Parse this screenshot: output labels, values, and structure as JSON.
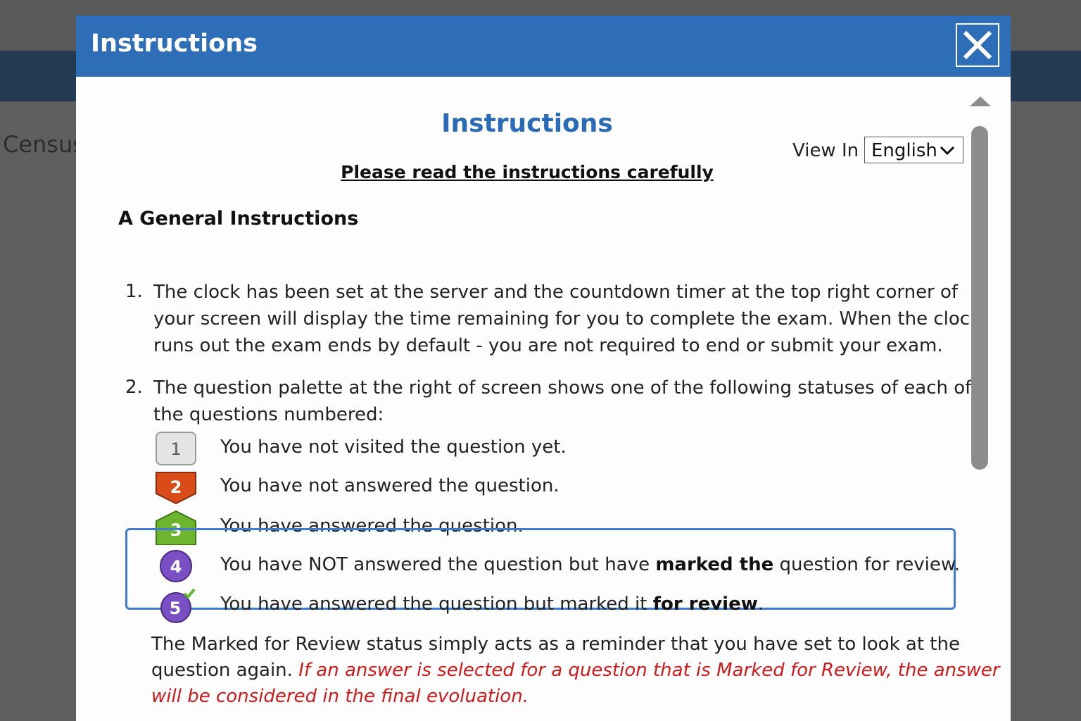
{
  "background": {
    "label": "Census"
  },
  "modal": {
    "title": "Instructions",
    "close_icon": "close-icon"
  },
  "content": {
    "heading": "Instructions",
    "view_in_label": "View In",
    "language": {
      "selected": "English"
    },
    "subtitle": "Please read the instructions carefully",
    "section_title": "A General Instructions",
    "items": [
      {
        "number": "1.",
        "lines": [
          "The clock has been set at the server and the countdown timer at the top right corner of",
          "your screen will display the time remaining for you to complete the exam. When the clock",
          "runs out the exam ends by default - you are not required to end or submit your exam."
        ]
      },
      {
        "number": "2.",
        "lines": [
          "The question palette at the right of screen shows one of the following statuses of each of",
          "the questions numbered:"
        ]
      }
    ],
    "statuses": [
      {
        "badge": "1",
        "color": "#e6e6e6",
        "text": "You have not visited the question yet."
      },
      {
        "badge": "2",
        "color": "#d94c1a",
        "text": "You have not answered the question."
      },
      {
        "badge": "3",
        "color": "#6db52e",
        "text": "You have answered the question."
      },
      {
        "badge": "4",
        "color": "#7b4fc4",
        "text_pre": "You have NOT answered the question but have ",
        "text_bold": "marked the",
        "text_post": " question for review."
      },
      {
        "badge": "5",
        "color": "#7b4fc4",
        "text_pre": "You have answered the question but marked it ",
        "text_bold": "for review",
        "text_post": "."
      }
    ],
    "review_note": {
      "line1": "The Marked for Review status simply acts as a reminder that you have set to look at the",
      "line2_plain": "question again. ",
      "line2_italic": "If an answer is selected for a question that is Marked for Review, the answer",
      "line3_italic": "will be considered in the final evoluation."
    }
  },
  "colors": {
    "header_blue": "#2e6db8",
    "heading_blue": "#2a6bb8",
    "highlight_border": "#3c7cd2",
    "warning_red": "#d11919"
  }
}
